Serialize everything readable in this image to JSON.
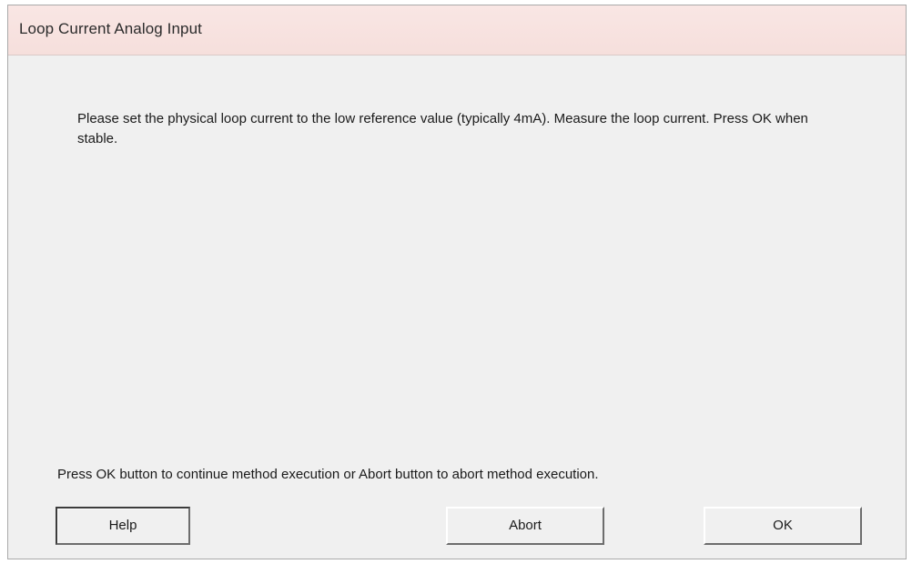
{
  "window": {
    "title": "Loop Current Analog Input"
  },
  "main": {
    "message": "Please set the physical loop current to the low reference value (typically 4mA). Measure the loop current. Press OK when stable.",
    "footer_text": "Press OK button to continue method execution or Abort button to abort method execution."
  },
  "buttons": {
    "help_label": "Help",
    "abort_label": "Abort",
    "ok_label": "OK"
  },
  "colors": {
    "titlebar": "#f8e3e1",
    "client_background": "#f0f0f0",
    "text": "#1a1a1a"
  }
}
